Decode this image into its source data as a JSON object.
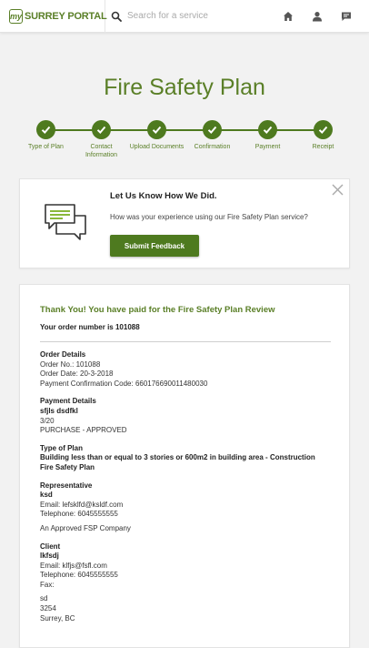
{
  "header": {
    "logo_badge": "my",
    "logo_text": "SURREY PORTAL",
    "search_placeholder": "Search for a service"
  },
  "page": {
    "title": "Fire Safety Plan"
  },
  "steps": [
    {
      "label": "Type of Plan",
      "complete": true
    },
    {
      "label": "Contact Information",
      "complete": true
    },
    {
      "label": "Upload Documents",
      "complete": true
    },
    {
      "label": "Confirmation",
      "complete": true
    },
    {
      "label": "Payment",
      "complete": true
    },
    {
      "label": "Receipt",
      "complete": true
    }
  ],
  "feedback": {
    "heading": "Let Us Know How We Did.",
    "question": "How was your experience using our Fire Safety Plan service?",
    "button": "Submit Feedback"
  },
  "receipt": {
    "thanks": "Thank You! You have paid for the Fire Safety Plan Review",
    "order_number": "Your order number is 101088",
    "order_details": {
      "heading": "Order Details",
      "order_no": "Order No.: 101088",
      "order_date": "Order Date: 20-3-2018",
      "confirmation": "Payment Confirmation Code: 660176690011480030"
    },
    "payment_details": {
      "heading": "Payment Details",
      "name": "sfjls dsdfkl",
      "date": "3/20",
      "status": "PURCHASE - APPROVED"
    },
    "type_of_plan": {
      "heading": "Type of Plan",
      "value": "Building less than or equal to 3 stories or 600m2 in building area - Construction Fire Safety Plan"
    },
    "representative": {
      "heading": "Representative",
      "name": "ksd",
      "email": "Email: lefsklfd@ksldf.com",
      "telephone": "Telephone: 6045555555",
      "company": "An Approved FSP Company"
    },
    "client": {
      "heading": "Client",
      "name": "lkfsdj",
      "email": "Email: klfjs@fsfl.com",
      "telephone": "Telephone: 6045555555",
      "fax": "Fax:",
      "address_line1": "sd",
      "address_line2": "3254",
      "address_line3": "Surrey, BC"
    }
  },
  "colors": {
    "brand_green": "#4e7a1f",
    "title_green": "#5a7f27"
  }
}
